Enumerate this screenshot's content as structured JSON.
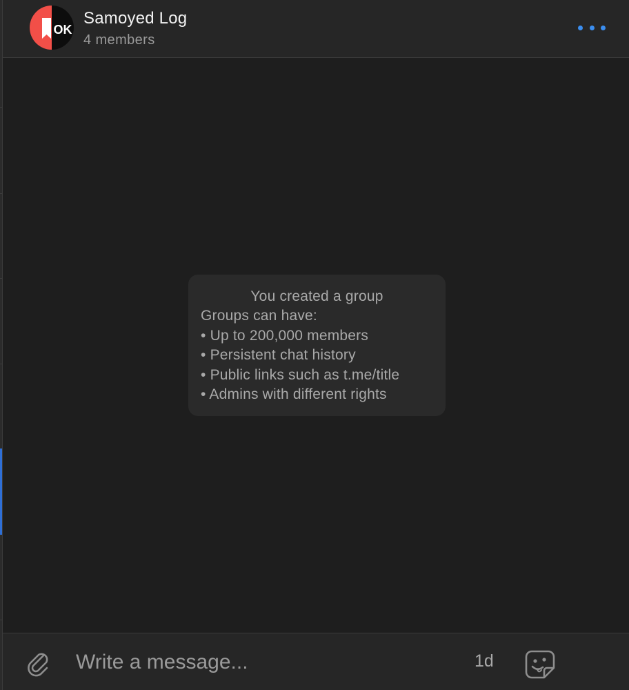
{
  "header": {
    "title": "Samoyed Log",
    "subtitle": "4 members",
    "avatar_text": "OK",
    "more_icon": "more-horizontal-icon"
  },
  "service_message": {
    "title": "You created a group",
    "lines": [
      "Groups can have:",
      "• Up to 200,000 members",
      "• Persistent chat history",
      "• Public links such as t.me/title",
      "• Admins with different rights"
    ]
  },
  "composer": {
    "placeholder": "Write a message...",
    "timer_label": "1d",
    "attach_icon": "paperclip-icon",
    "sticker_icon": "sticker-face-icon"
  },
  "colors": {
    "accent": "#3b8ef0",
    "avatar_red": "#f24f48",
    "background": "#1e1e1e",
    "panel": "#262626",
    "active_indicator": "#2f6fd6"
  }
}
